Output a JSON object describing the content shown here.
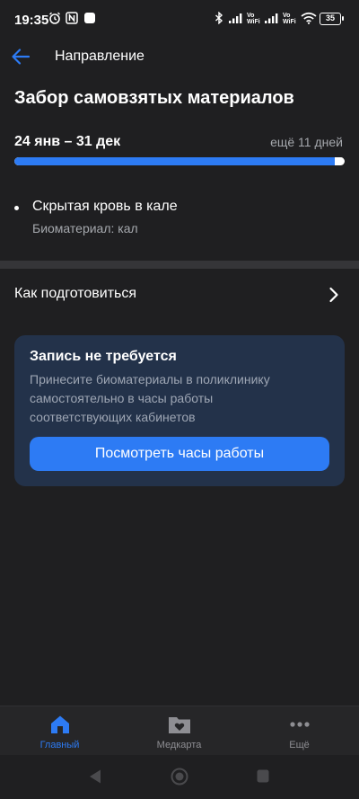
{
  "status_bar": {
    "time": "19:35",
    "volte1": [
      "Vo",
      "WiFi"
    ],
    "volte2": [
      "Vo",
      "WiFi"
    ],
    "battery": "35"
  },
  "app_bar": {
    "title": "Направление"
  },
  "page": {
    "title": "Забор самовзятых материалов",
    "date_range": "24 янв – 31 дек",
    "days_left": "ещё 11 дней",
    "progress_fraction": 0.97
  },
  "service": {
    "name": "Скрытая кровь в кале",
    "biomaterial": "Биоматериал: кал"
  },
  "prepare": {
    "label": "Как подготовиться"
  },
  "card": {
    "title": "Запись не требуется",
    "text": "Принесите биоматериалы в поликлинику самостоятельно в часы работы соответствующих кабинетов",
    "button": "Посмотреть часы работы"
  },
  "bottom_nav": {
    "items": [
      {
        "label": "Главный",
        "icon": "home-icon",
        "active": true
      },
      {
        "label": "Медкарта",
        "icon": "medcard-icon",
        "active": false
      },
      {
        "label": "Ещё",
        "icon": "more-icon",
        "active": false
      }
    ]
  },
  "colors": {
    "background": "#1f1f21",
    "accent": "#2d7bf4",
    "card": "#23324a",
    "muted_text": "#a5a8ad",
    "inactive_nav": "#8e8e93"
  }
}
